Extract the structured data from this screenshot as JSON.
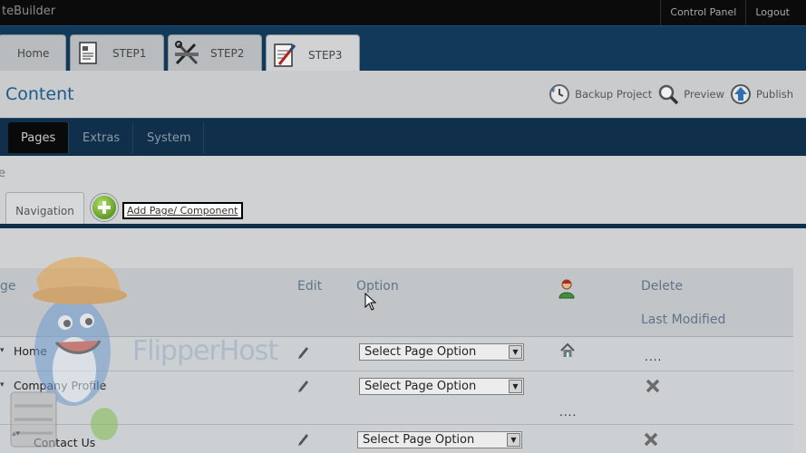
{
  "topbar": {
    "brand": "teBuilder",
    "links": [
      "Control Panel",
      "Logout"
    ]
  },
  "steps": [
    {
      "label": "Home",
      "icon": "home-icon"
    },
    {
      "label": "STEP1",
      "icon": "document-icon"
    },
    {
      "label": "STEP2",
      "icon": "tools-icon"
    },
    {
      "label": "STEP3",
      "icon": "edit-document-icon",
      "active": true
    }
  ],
  "header": {
    "title": "Content",
    "actions": [
      {
        "label": "Backup Project",
        "icon": "backup-icon"
      },
      {
        "label": "Preview",
        "icon": "magnifier-icon"
      },
      {
        "label": "Publish",
        "icon": "publish-icon"
      }
    ]
  },
  "section_tabs": [
    {
      "label": "Pages",
      "active": true
    },
    {
      "label": "Extras"
    },
    {
      "label": "System"
    }
  ],
  "breadcrumb": "e",
  "nav_tab": "Navigation",
  "add_link": "Add Page/ Component",
  "table": {
    "headers": {
      "page": "ge",
      "edit": "Edit",
      "option": "Option",
      "delete": "Delete",
      "last_modified": "Last Modified"
    },
    "rows": [
      {
        "name": "Home",
        "option": "Select Page Option",
        "marker": "home-icon",
        "modified": "...."
      },
      {
        "name": "Company Profile",
        "option": "Select Page Option",
        "marker": "delete-icon",
        "modified": "...."
      },
      {
        "name": "Contact Us",
        "option": "Select Page Option",
        "marker": "delete-icon"
      }
    ]
  },
  "watermark": "FlipperHost",
  "colors": {
    "accent_blue": "#1d5a8c",
    "nav_dark": "#0f2f4a",
    "step_bar": "#11395a"
  }
}
